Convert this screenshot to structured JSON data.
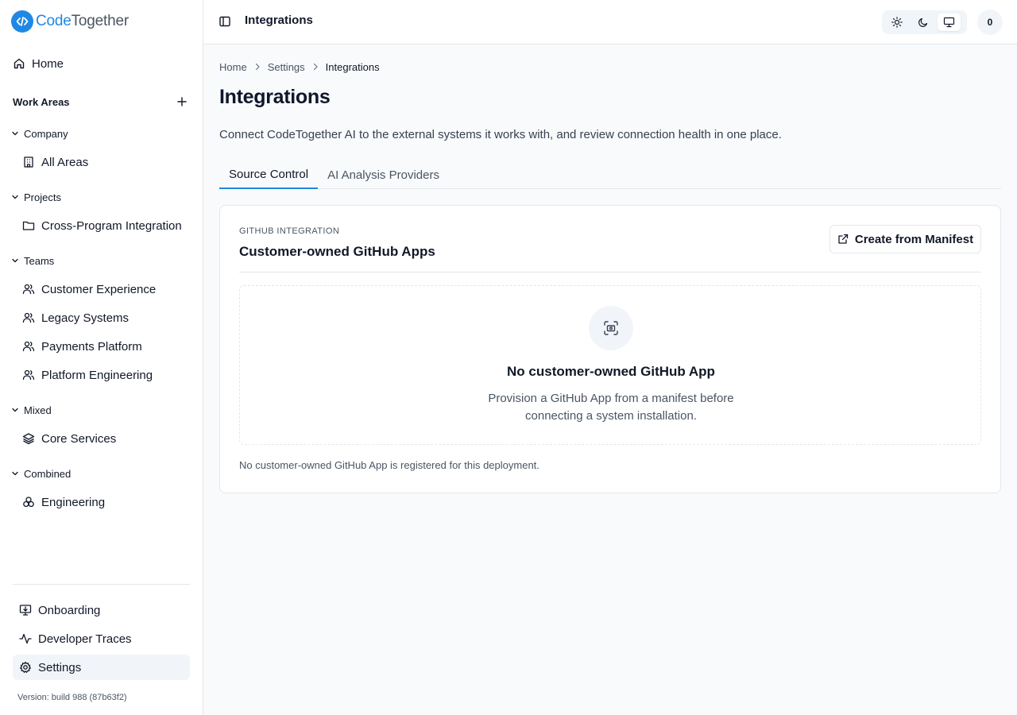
{
  "brand": {
    "name_part1": "Code",
    "name_part2": "Together"
  },
  "sidebar": {
    "home": "Home",
    "work_areas_title": "Work Areas",
    "groups": {
      "company": {
        "label": "Company",
        "items": [
          "All Areas"
        ]
      },
      "projects": {
        "label": "Projects",
        "items": [
          "Cross-Program Integration"
        ]
      },
      "teams": {
        "label": "Teams",
        "items": [
          "Customer Experience",
          "Legacy Systems",
          "Payments Platform",
          "Platform Engineering"
        ]
      },
      "mixed": {
        "label": "Mixed",
        "items": [
          "Core Services"
        ]
      },
      "combined": {
        "label": "Combined",
        "items": [
          "Engineering"
        ]
      }
    },
    "bottom": {
      "onboarding": "Onboarding",
      "developer_traces": "Developer Traces",
      "settings": "Settings"
    },
    "version": "Version: build 988 (87b63f2)"
  },
  "topbar": {
    "title": "Integrations",
    "avatar_initial": "0",
    "theme_active": "system"
  },
  "breadcrumb": [
    "Home",
    "Settings",
    "Integrations"
  ],
  "page": {
    "title": "Integrations",
    "description": "Connect CodeTogether AI to the external systems it works with, and review connection health in one place."
  },
  "tabs": [
    {
      "label": "Source Control",
      "active": true
    },
    {
      "label": "AI Analysis Providers",
      "active": false
    }
  ],
  "card": {
    "kicker": "GITHUB INTEGRATION",
    "heading": "Customer-owned GitHub Apps",
    "manifest_button": "Create from Manifest",
    "empty_title": "No customer-owned GitHub App",
    "empty_desc": "Provision a GitHub App from a manifest before connecting a system installation.",
    "footnote": "No customer-owned GitHub App is registered for this deployment."
  },
  "colors": {
    "accent": "#1e88e5",
    "text": "#111827",
    "muted": "#4b5563",
    "border": "#e5e7eb"
  }
}
